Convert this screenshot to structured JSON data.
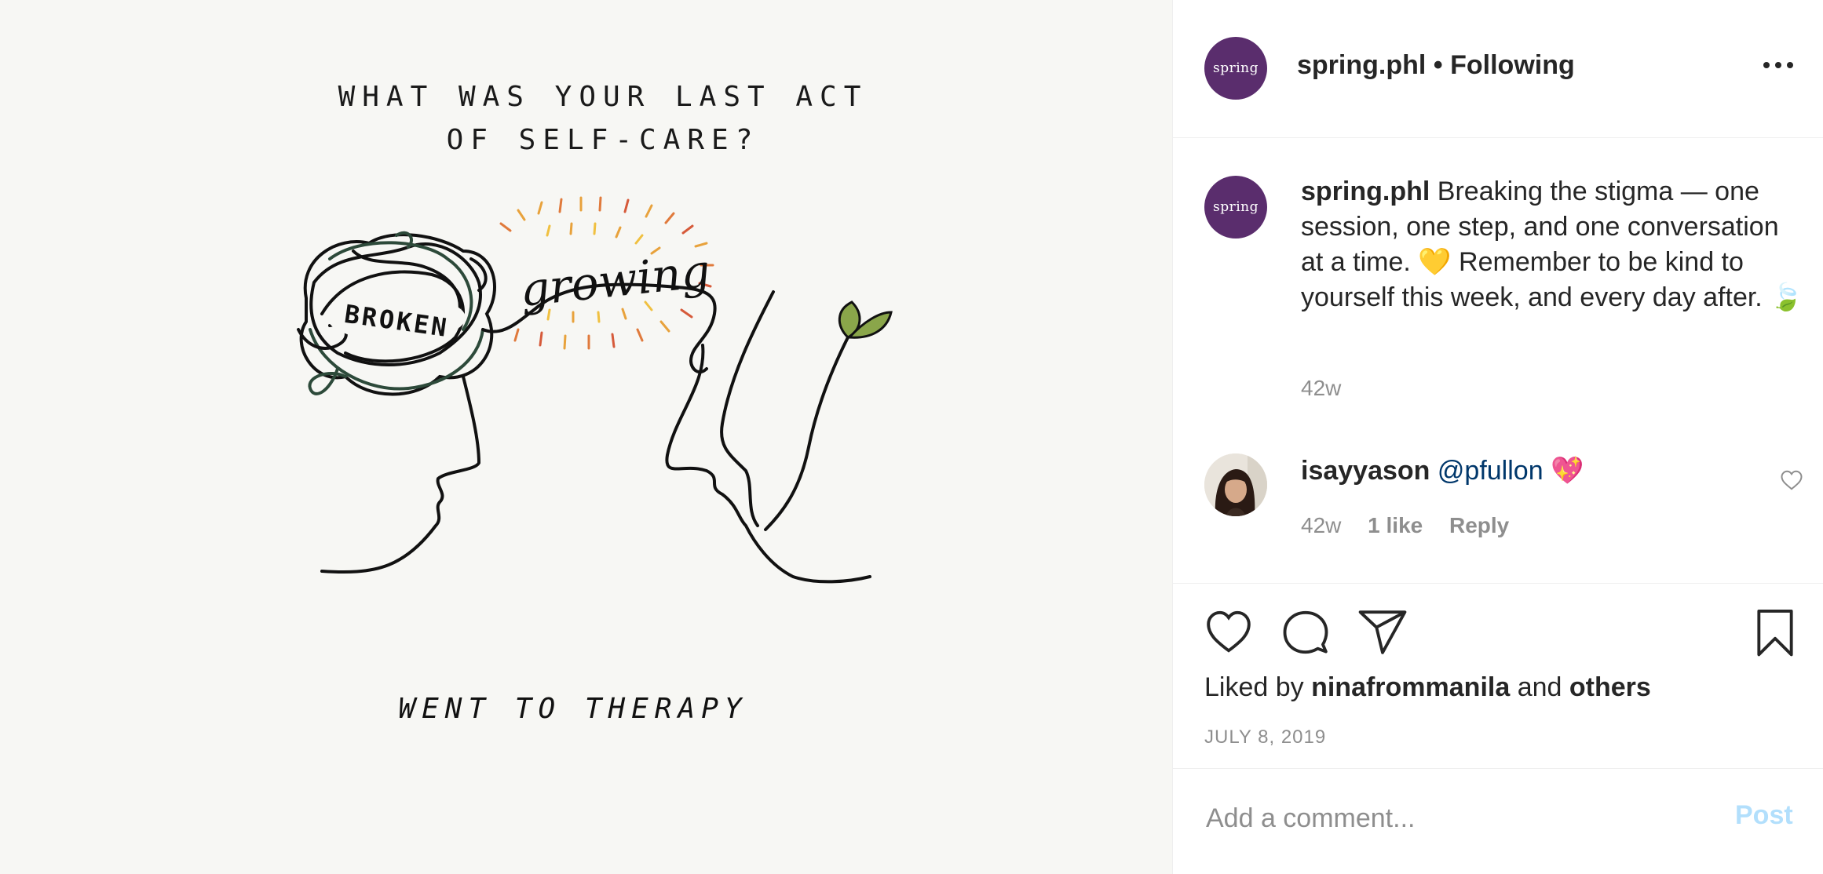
{
  "post_image": {
    "title_line1": "WHAT WAS YOUR LAST ACT",
    "title_line2": "OF SELF-CARE?",
    "word_broken": "BROKEN",
    "word_growing": "growing",
    "bottom_text": "WENT TO THERAPY"
  },
  "header": {
    "avatar_text": "spring",
    "username": "spring.phl",
    "separator": " • ",
    "follow_status": "Following",
    "more_icon": "more-horizontal-icon"
  },
  "caption": {
    "avatar_text": "spring",
    "username": "spring.phl",
    "text": "Breaking the stigma — one session, one step, and one conversation at a time. 💛  Remember to be kind to yourself this week, and every day after. 🍃",
    "time": "42w"
  },
  "comments": [
    {
      "username": "isayyason",
      "mention": "@pfullon",
      "emoji": "💖",
      "time": "42w",
      "likes": "1 like",
      "reply_label": "Reply",
      "heart_icon": "heart-outline-icon"
    }
  ],
  "actions": {
    "like_icon": "heart-icon",
    "comment_icon": "comment-bubble-icon",
    "share_icon": "paper-plane-icon",
    "save_icon": "bookmark-icon"
  },
  "likes": {
    "prefix": "Liked by",
    "user": "ninafrommanila",
    "conjunction": "and",
    "others": "others"
  },
  "post_date": "JULY 8, 2019",
  "comment_box": {
    "placeholder": "Add a comment...",
    "post_label": "Post"
  },
  "colors": {
    "brand_purple": "#5a2d6d",
    "post_button_disabled": "#b2dffc",
    "mention_link": "#00376b",
    "muted_text": "#8e8e8e"
  }
}
